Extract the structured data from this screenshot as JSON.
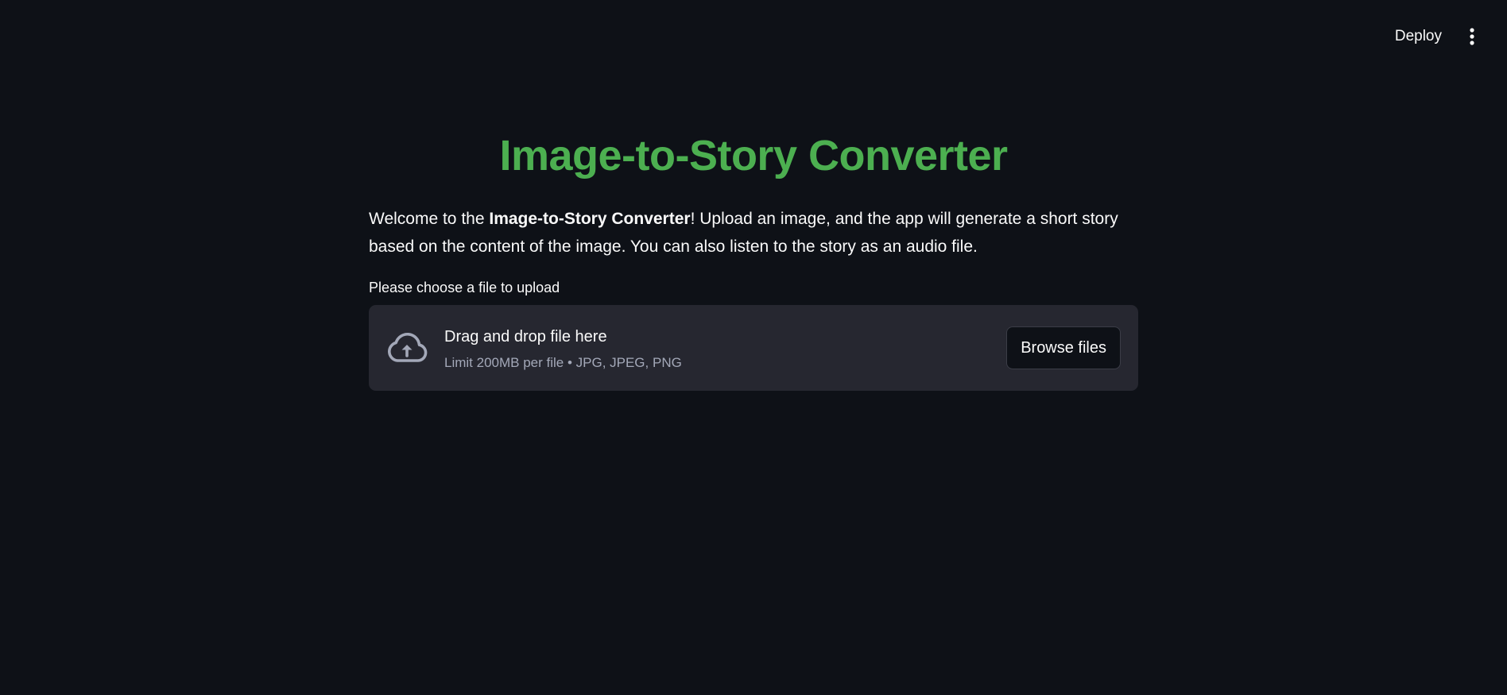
{
  "header": {
    "deploy_label": "Deploy",
    "menu_icon": "kebab-menu-icon"
  },
  "main": {
    "title": "Image-to-Story Converter",
    "intro": {
      "prefix": "Welcome to the ",
      "bold": "Image-to-Story Converter",
      "suffix": "! Upload an image, and the app will generate a short story based on the content of the image. You can also listen to the story as an audio file."
    },
    "uploader": {
      "label": "Please choose a file to upload",
      "drag_text": "Drag and drop file here",
      "limit_text": "Limit 200MB per file • JPG, JPEG, PNG",
      "browse_label": "Browse files",
      "icon": "cloud-upload-icon"
    }
  },
  "colors": {
    "background": "#0e1117",
    "title": "#4caf50",
    "dropzone": "#262730",
    "muted_text": "#a3a8b8"
  }
}
